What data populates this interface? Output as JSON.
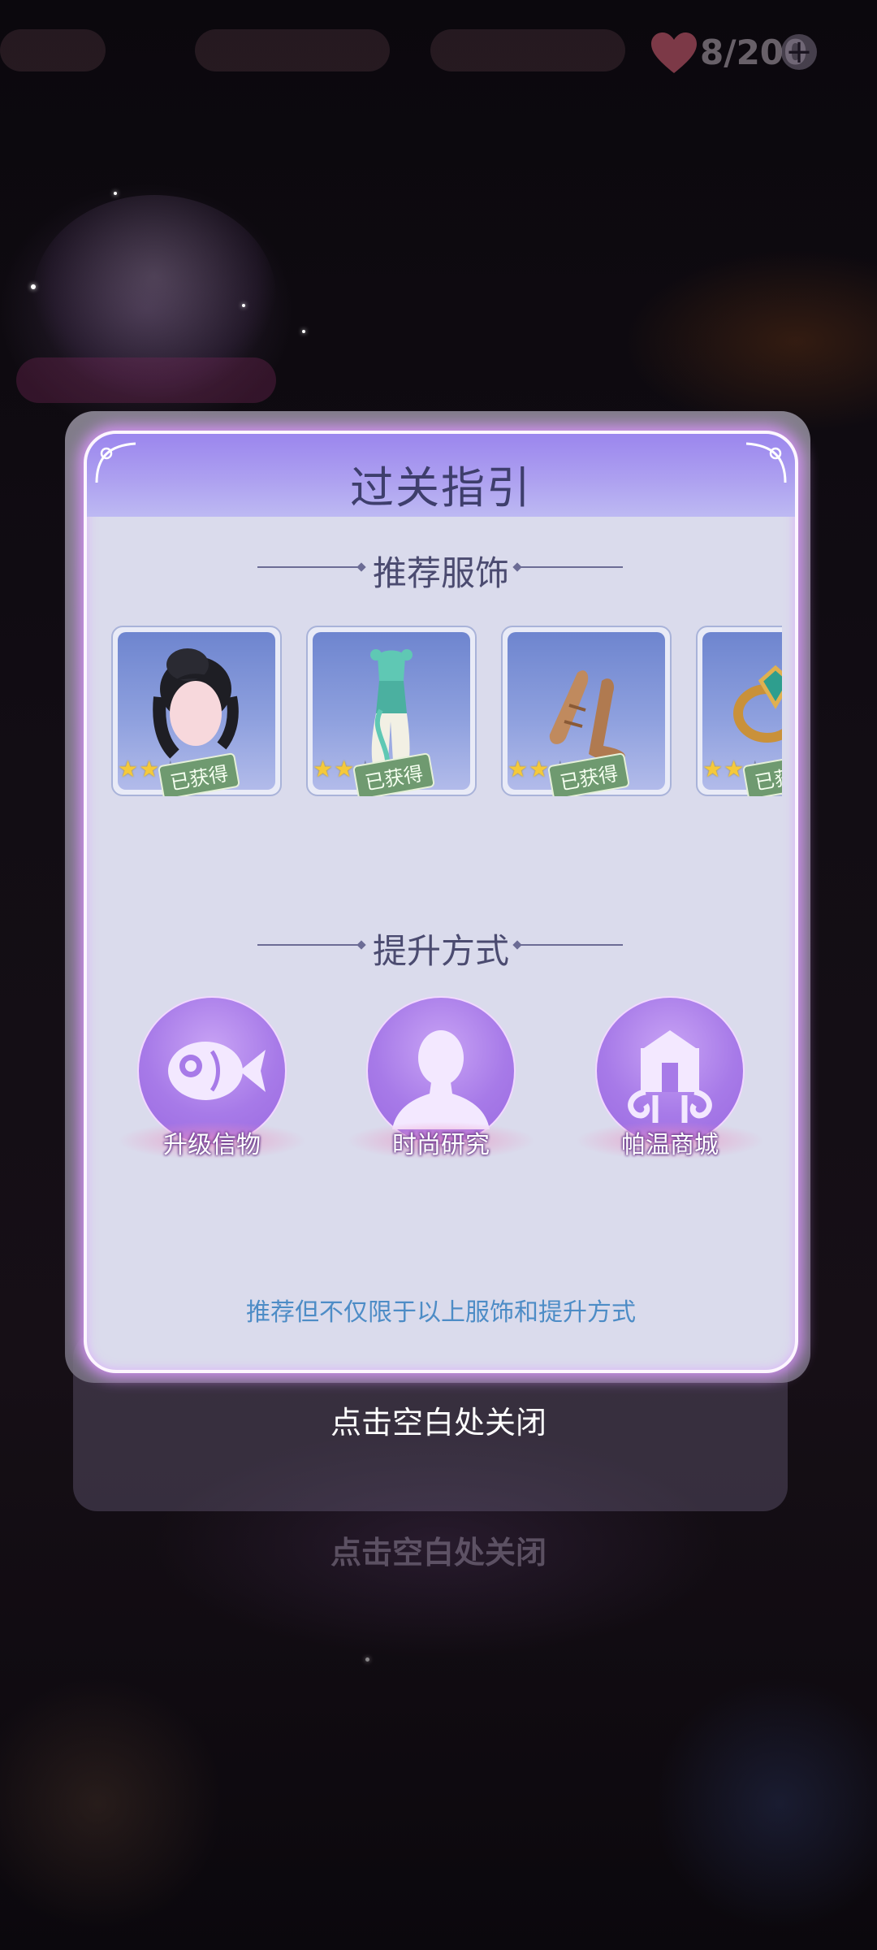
{
  "hud": {
    "heart_count": "8/200",
    "plus": "+"
  },
  "modal": {
    "title": "过关指引",
    "section_outfits": "推荐服饰",
    "section_methods": "提升方式",
    "footnote": "推荐但不仅限于以上服饰和提升方式",
    "items": [
      {
        "name": "hair",
        "stars_on": 2,
        "stars_total": 5,
        "badge": "已获得"
      },
      {
        "name": "dress",
        "stars_on": 2,
        "stars_total": 5,
        "badge": "已获得"
      },
      {
        "name": "shoes",
        "stars_on": 2,
        "stars_total": 5,
        "badge": "已获得"
      },
      {
        "name": "ring",
        "stars_on": 2,
        "stars_total": 5,
        "badge": "已获得"
      }
    ],
    "methods": [
      {
        "label": "升级信物",
        "icon": "fish-icon"
      },
      {
        "label": "时尚研究",
        "icon": "silhouette-icon"
      },
      {
        "label": "帕温商城",
        "icon": "shop-icon"
      }
    ]
  },
  "close_hint": "点击空白处关闭",
  "background_close_hint": "点击空白处关闭",
  "colors": {
    "header": "#9b86ee",
    "panel": "#dadbec",
    "glow": "#dc96ff",
    "footnote": "#4d8cc6",
    "badge": "#6f9a70"
  }
}
